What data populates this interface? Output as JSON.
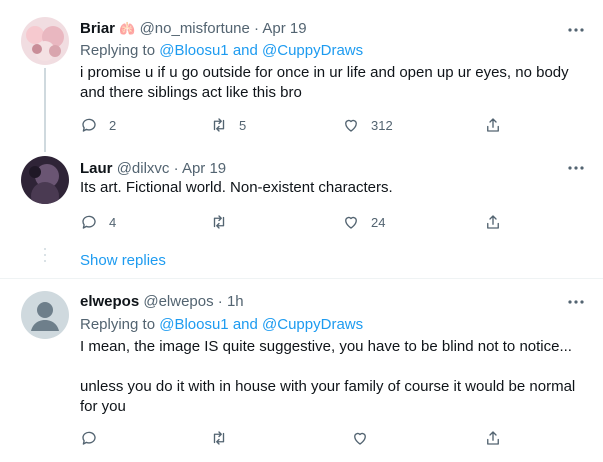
{
  "tweets": [
    {
      "name": "Briar",
      "name_emoji": "🫁",
      "handle": "@no_misfortune",
      "time": "Apr 19",
      "replying_prefix": "Replying to ",
      "replying_user1": "@Bloosu1",
      "replying_and": " and ",
      "replying_user2": "@CuppyDraws",
      "text": "i promise u if u go outside for once in ur life and open up ur eyes, no body and there siblings act like this bro",
      "replies": "2",
      "retweets": "5",
      "likes": "312",
      "avatar_color": "#e8c9cf"
    },
    {
      "name": "Laur",
      "handle": "@dilxvc",
      "time": "Apr 19",
      "text": "Its art. Fictional world. Non-existent characters.",
      "replies": "4",
      "retweets": "",
      "likes": "24",
      "avatar_color": "#3b2e45"
    },
    {
      "name": "elwepos",
      "handle": "@elwepos",
      "time": "1h",
      "replying_prefix": "Replying to ",
      "replying_user1": "@Bloosu1",
      "replying_and": " and ",
      "replying_user2": "@CuppyDraws",
      "text_line1": "I mean, the image IS quite suggestive, you have to be blind not to notice...",
      "text_line2": "unless you do it with in house with  your family of course it would be normal for you",
      "replies": "",
      "retweets": "",
      "likes": "",
      "avatar_color": "#cfd9de"
    }
  ],
  "show_replies": "Show replies",
  "separator": "·",
  "colors": {
    "accent": "#1d9bf0",
    "muted": "#536471",
    "text": "#0f1419"
  },
  "icons": [
    "reply-icon",
    "retweet-icon",
    "like-icon",
    "share-icon",
    "more-icon"
  ]
}
